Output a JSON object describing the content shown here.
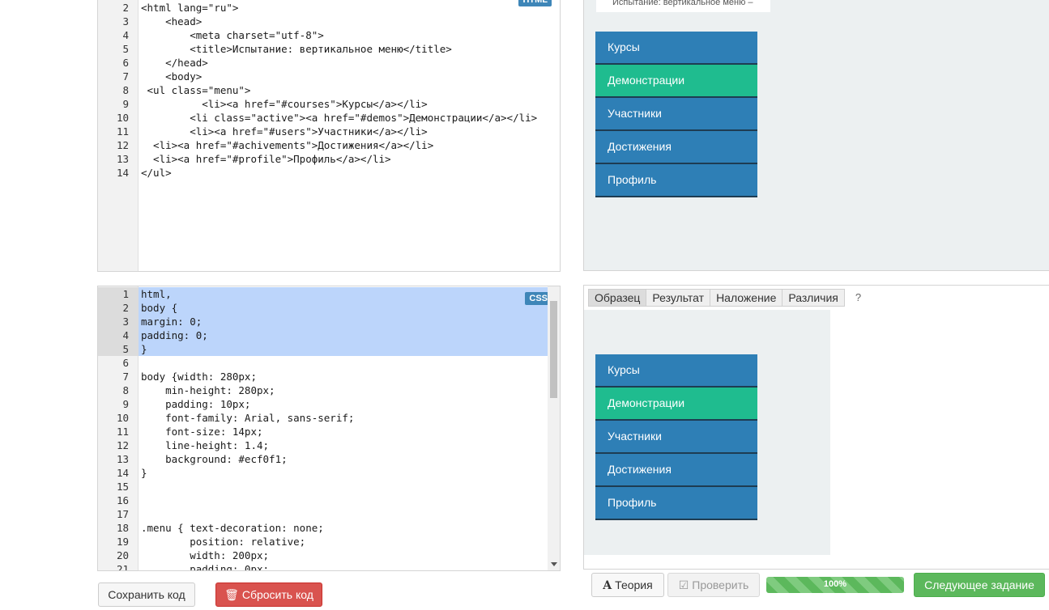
{
  "html_editor": {
    "badge": "HTML",
    "lines": [
      {
        "n": "2",
        "code": "<html lang=\"ru\">"
      },
      {
        "n": "3",
        "code": "    <head>"
      },
      {
        "n": "4",
        "code": "        <meta charset=\"utf-8\">"
      },
      {
        "n": "5",
        "code": "        <title>Испытание: вертикальное меню</title>"
      },
      {
        "n": "6",
        "code": "    </head>"
      },
      {
        "n": "7",
        "code": "    <body>"
      },
      {
        "n": "8",
        "code": " <ul class=\"menu\">"
      },
      {
        "n": "9",
        "code": "          <li><a href=\"#courses\">Курсы</a></li>"
      },
      {
        "n": "10",
        "code": "        <li class=\"active\"><a href=\"#demos\">Демонстрации</a></li>"
      },
      {
        "n": "11",
        "code": "        <li><a href=\"#users\">Участники</a></li>"
      },
      {
        "n": "12",
        "code": "  <li><a href=\"#achivements\">Достижения</a></li>"
      },
      {
        "n": "13",
        "code": "  <li><a href=\"#profile\">Профиль</a></li>"
      },
      {
        "n": "14",
        "code": "</ul>"
      }
    ]
  },
  "css_editor": {
    "badge": "CSS",
    "lines": [
      {
        "n": "1",
        "code": "html,",
        "selected": true
      },
      {
        "n": "2",
        "code": "body {",
        "selected": true
      },
      {
        "n": "3",
        "code": "margin: 0;",
        "selected": true
      },
      {
        "n": "4",
        "code": "padding: 0;",
        "selected": true
      },
      {
        "n": "5",
        "code": "}",
        "selected": true
      },
      {
        "n": "6",
        "code": ""
      },
      {
        "n": "7",
        "code": "body {width: 280px;"
      },
      {
        "n": "8",
        "code": "    min-height: 280px;"
      },
      {
        "n": "9",
        "code": "    padding: 10px;"
      },
      {
        "n": "10",
        "code": "    font-family: Arial, sans-serif;"
      },
      {
        "n": "11",
        "code": "    font-size: 14px;"
      },
      {
        "n": "12",
        "code": "    line-height: 1.4;"
      },
      {
        "n": "13",
        "code": "    background: #ecf0f1;"
      },
      {
        "n": "14",
        "code": "}"
      },
      {
        "n": "15",
        "code": ""
      },
      {
        "n": "16",
        "code": ""
      },
      {
        "n": "17",
        "code": ""
      },
      {
        "n": "18",
        "code": ".menu { text-decoration: none;"
      },
      {
        "n": "19",
        "code": "        position: relative;"
      },
      {
        "n": "20",
        "code": "        width: 200px;"
      },
      {
        "n": "21",
        "code": "        padding: 0px;"
      }
    ]
  },
  "result_pane": {
    "title_strip": "Испытание: вертикальное меню –",
    "menu": [
      {
        "label": "Курсы",
        "active": false
      },
      {
        "label": "Демонстрации",
        "active": true
      },
      {
        "label": "Участники",
        "active": false
      },
      {
        "label": "Достижения",
        "active": false
      },
      {
        "label": "Профиль",
        "active": false
      }
    ]
  },
  "sample_pane": {
    "tabs": [
      {
        "label": "Образец",
        "active": true
      },
      {
        "label": "Результат",
        "active": false
      },
      {
        "label": "Наложение",
        "active": false
      },
      {
        "label": "Различия",
        "active": false
      }
    ],
    "help": "?",
    "menu": [
      {
        "label": "Курсы",
        "active": false
      },
      {
        "label": "Демонстрации",
        "active": true
      },
      {
        "label": "Участники",
        "active": false
      },
      {
        "label": "Достижения",
        "active": false
      },
      {
        "label": "Профиль",
        "active": false
      }
    ]
  },
  "buttons": {
    "save": "Сохранить код",
    "reset": "Сбросить код",
    "theory": "Теория",
    "check": "Проверить",
    "next": "Следующее задание"
  },
  "icons": {
    "reset": "trash-icon",
    "theory": "font-a-icon",
    "check": "check-square-icon"
  },
  "progress": {
    "label": "100%",
    "value": 100
  },
  "colors": {
    "menu_item": "#2e7fb6",
    "menu_active": "#1fbc8f",
    "menu_divider": "#1e3c52",
    "pane_bg": "#ecf0f1",
    "selection": "#bcd5fb",
    "badge": "#3e86b8",
    "reset_button": "#d9534f",
    "next_button": "#5cb85c"
  }
}
